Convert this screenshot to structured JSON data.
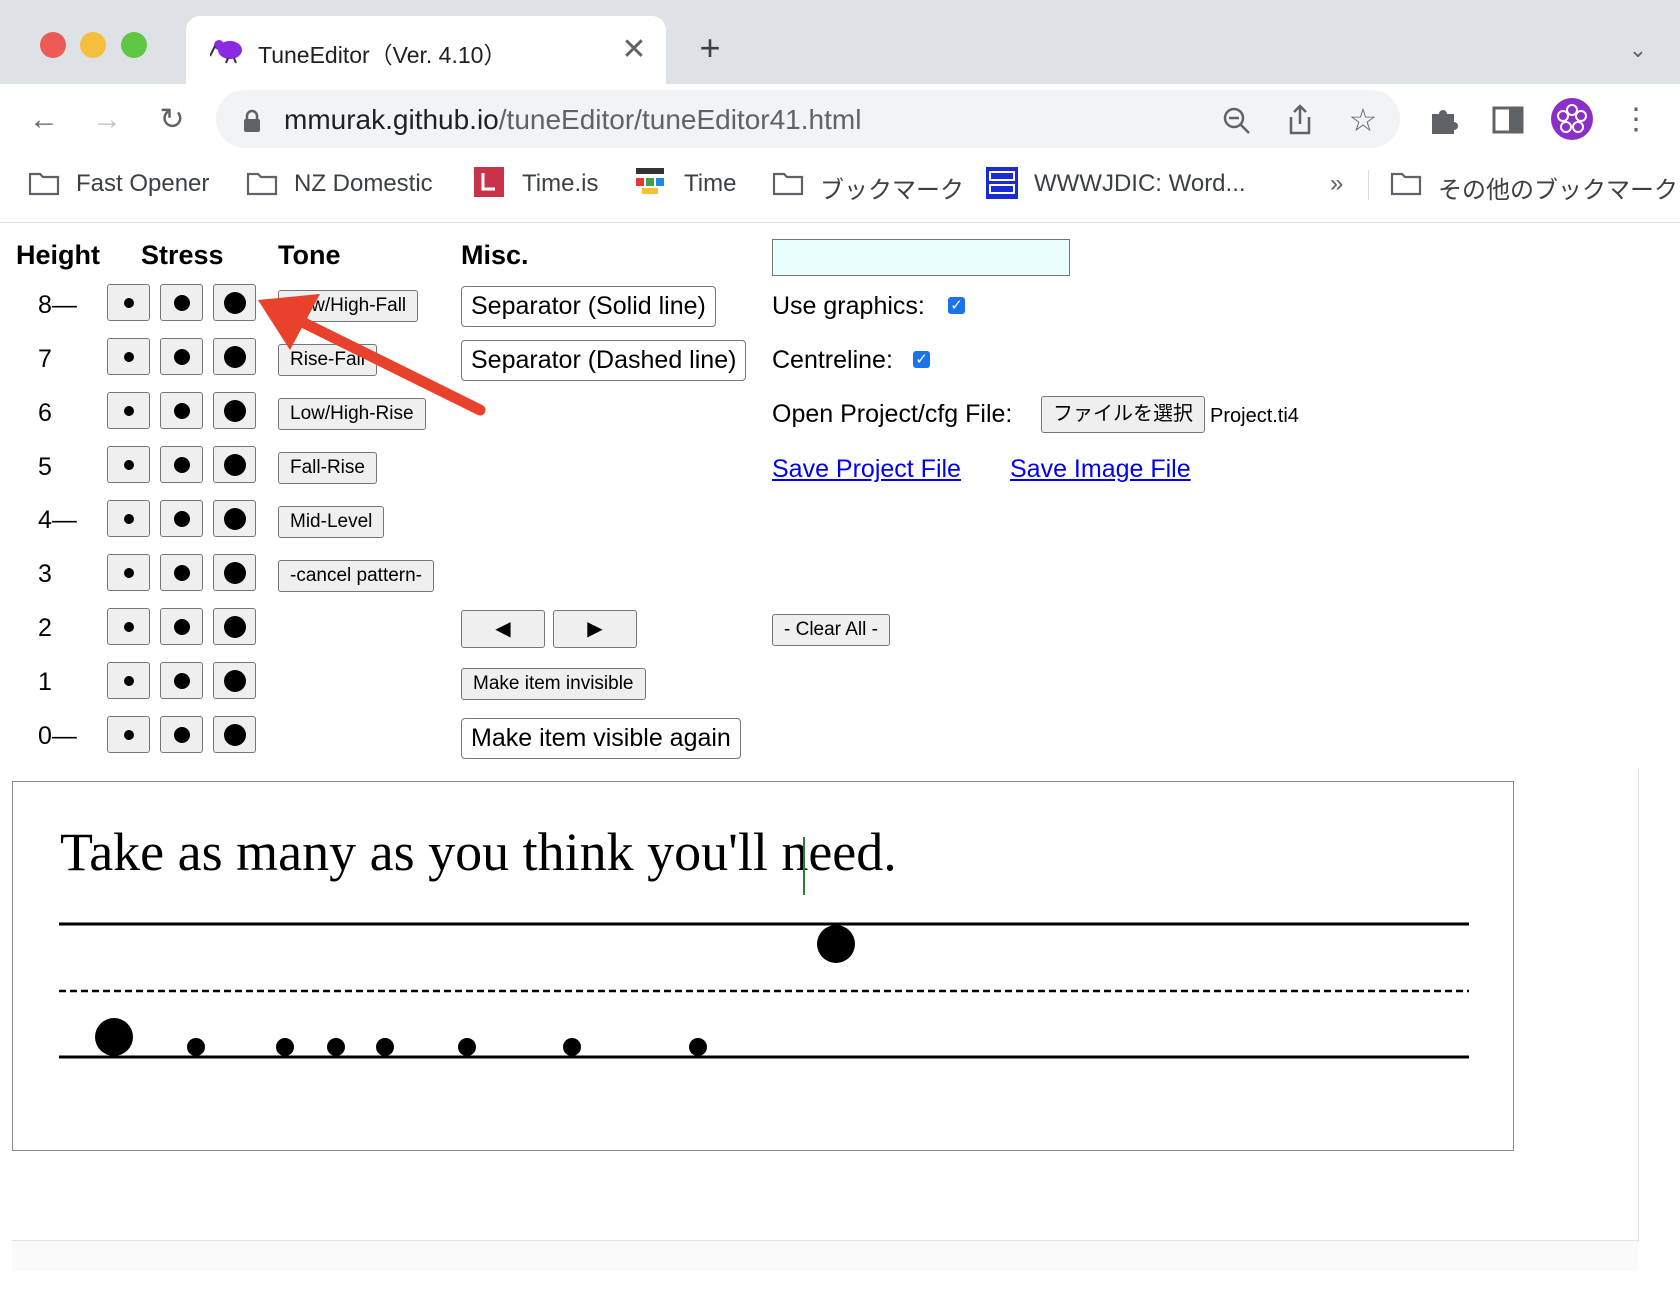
{
  "browser": {
    "tab_title": "TuneEditor（Ver. 4.10）",
    "url_host": "mmurak.github.io",
    "url_path": "/tuneEditor/tuneEditor41.html",
    "bookmarks": [
      "Fast Opener",
      "NZ Domestic",
      "Time.is",
      "Time",
      "ブックマーク",
      "WWWJDIC: Word...",
      "»",
      "その他のブックマーク"
    ]
  },
  "headers": {
    "height": "Height",
    "stress": "Stress",
    "tone": "Tone",
    "misc": "Misc."
  },
  "heights": [
    "8—",
    "7",
    "6",
    "5",
    "4—",
    "3",
    "2",
    "1",
    "0—"
  ],
  "tones": [
    "Low/High-Fall",
    "Rise-Fall",
    "Low/High-Rise",
    "Fall-Rise",
    "Mid-Level",
    "-cancel pattern-"
  ],
  "misc": {
    "separator_solid": "Separator (Solid line)",
    "separator_dashed": "Separator (Dashed line)",
    "prev_arrow": "◀",
    "next_arrow": "▶",
    "make_invisible": "Make item invisible",
    "make_visible": "Make item visible again"
  },
  "options": {
    "text_input_value": "",
    "use_graphics_label": "Use graphics:",
    "use_graphics": true,
    "centreline_label": "Centreline:",
    "centreline": true,
    "open_file_label": "Open Project/cfg File:",
    "choose_file_button": "ファイルを選択",
    "chosen_file": "Project.ti4",
    "save_project": "Save Project File",
    "save_image": "Save Image File",
    "clear_all": "- Clear All -"
  },
  "canvas": {
    "sentence": "Take as many as you think you'll need."
  },
  "annotation": {
    "arrow_color": "#e8412c"
  }
}
